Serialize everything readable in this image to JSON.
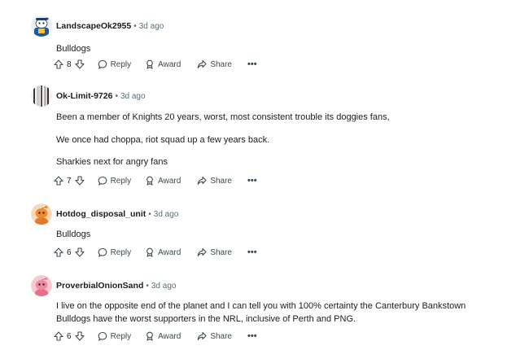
{
  "labels": {
    "reply": "Reply",
    "award": "Award",
    "share": "Share",
    "more": "•••",
    "separator": "•"
  },
  "comments": [
    {
      "author": "LandscapeOk2955",
      "time": "3d ago",
      "lines": [
        "Bulldogs"
      ],
      "votes": "8",
      "avatar": "snoo-avatar-blue"
    },
    {
      "author": "Ok-Limit-9726",
      "time": "3d ago",
      "lines": [
        "Been a member of Knights 20 years, worst, most consistent trouble its doggies fans,",
        "We once had choppa, riot squad up a few years back.",
        "Sharkies next for angry fans"
      ],
      "votes": "7",
      "avatar": "photo-avatar"
    },
    {
      "author": "Hotdog_disposal_unit",
      "time": "3d ago",
      "lines": [
        "Bulldogs"
      ],
      "votes": "6",
      "avatar": "snoo-avatar-orange"
    },
    {
      "author": "ProverbialOnionSand",
      "time": "3d ago",
      "lines": [
        "I live on the opposite end of the planet and I can tell you with 100% certainty the Canterbury Bankstown",
        "Bulldogs have the worst supporters in the NRL, inclusive of Perth and PNG."
      ],
      "votes": "6",
      "avatar": "snoo-avatar-pink"
    }
  ]
}
